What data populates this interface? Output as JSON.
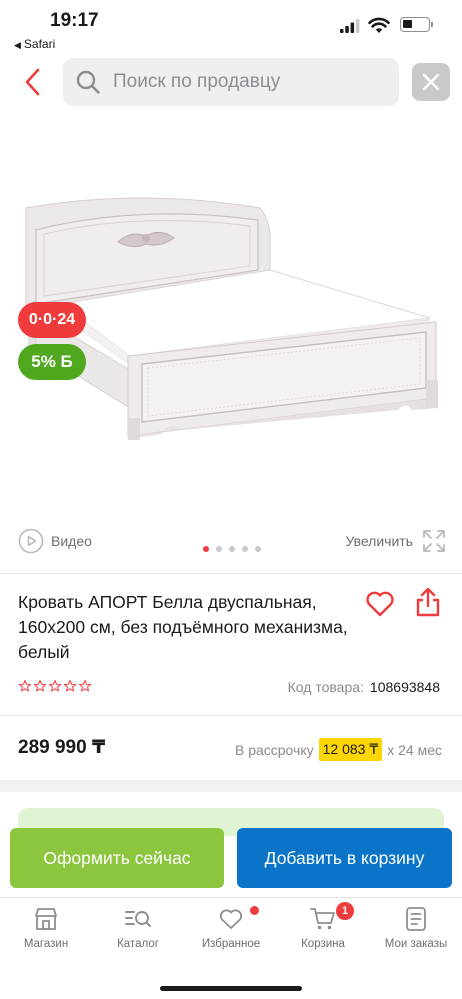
{
  "status_bar": {
    "time": "19:17",
    "back_app": "Safari"
  },
  "search": {
    "placeholder": "Поиск по продавцу"
  },
  "product": {
    "badge_sale": "0·0·24",
    "badge_bonus": "5% Б",
    "media": {
      "video_label": "Видео",
      "zoom_label": "Увеличить",
      "image_count": 5,
      "active_image": 1
    },
    "title": "Кровать АПОРТ Белла двуспальная, 160х200 см, без подъёмного механизма, белый",
    "rating_stars": 0,
    "code_label": "Код товара:",
    "code_value": "108693848",
    "price": "289 990 ₸",
    "installment_prefix": "В рассрочку",
    "installment_amount": "12 083 ₸",
    "installment_suffix": "х 24 мес"
  },
  "actions": {
    "buy_now": "Оформить сейчас",
    "add_to_cart": "Добавить в корзину"
  },
  "tabbar": {
    "items": [
      {
        "label": "Магазин",
        "icon": "shop-icon"
      },
      {
        "label": "Каталог",
        "icon": "catalog-search-icon"
      },
      {
        "label": "Избранное",
        "icon": "heart-icon"
      },
      {
        "label": "Корзина",
        "icon": "cart-icon",
        "badge": "1"
      },
      {
        "label": "Мои заказы",
        "icon": "orders-icon"
      }
    ]
  },
  "colors": {
    "accent_red": "#ef3b3b",
    "buy_green": "#8cc63f",
    "cart_blue": "#0a74c9",
    "bonus_green": "#4fa81e",
    "highlight_yellow": "#ffd600"
  }
}
